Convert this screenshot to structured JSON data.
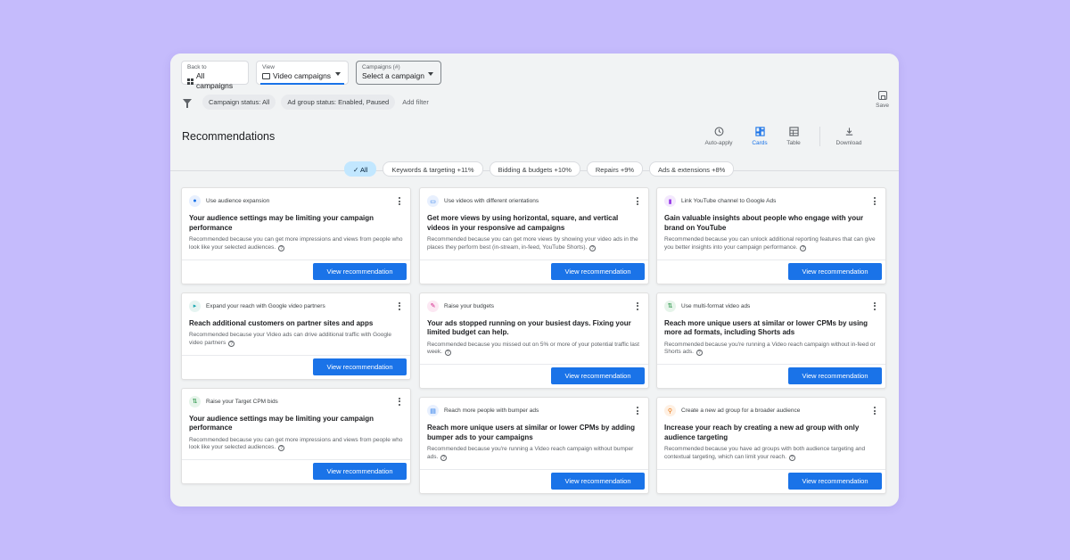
{
  "selectors": {
    "back": {
      "sub": "Back to",
      "main": "All campaigns"
    },
    "view": {
      "sub": "View",
      "main": "Video campaigns"
    },
    "campaigns": {
      "sub": "Campaigns (#)",
      "main": "Select a campaign"
    }
  },
  "filters": {
    "chips": [
      "Campaign status: All",
      "Ad group status: Enabled, Paused"
    ],
    "add_label": "Add filter"
  },
  "save_label": "Save",
  "page_title": "Recommendations",
  "view_buttons": {
    "auto_apply": "Auto-apply",
    "cards": "Cards",
    "table": "Table",
    "download": "Download"
  },
  "categories": [
    "All",
    "Keywords & targeting +11%",
    "Bidding & budgets +10%",
    "Repairs +9%",
    "Ads & extensions +8%"
  ],
  "view_recommendation_label": "View recommendation",
  "help_glyph": "?",
  "columns": [
    [
      {
        "category": "Use audience expansion",
        "icon": "person-icon",
        "headline": "Your audience settings may be limiting your campaign performance",
        "reason": "Recommended because you can get more impressions and views from people who look like your selected audiences."
      },
      {
        "category": "Expand your reach with Google video partners",
        "icon": "expand-icon",
        "headline": "Reach additional customers on partner sites and apps",
        "reason": "Recommended because your Video ads can drive additional traffic with Google video partners"
      },
      {
        "category": "Raise your Target CPM bids",
        "icon": "bids-icon",
        "headline": "Your audience settings may be limiting your campaign performance",
        "reason": "Recommended because you can get more impressions and views from people who look like your selected audiences."
      }
    ],
    [
      {
        "category": "Use videos with different orientations",
        "icon": "video-orientation-icon",
        "headline": "Get more views by using horizontal, square, and vertical videos in your responsive ad campaigns",
        "reason": "Recommended because you can get more views by showing your video ads in the places they perform best (in-stream, in-feed, YouTube Shorts)."
      },
      {
        "category": "Raise your budgets",
        "icon": "wrench-icon",
        "headline": "Your ads stopped running on your busiest days. Fixing your limited budget can help.",
        "reason": "Recommended because you missed out on 5% or more of your potential traffic last week."
      },
      {
        "category": "Reach more people with bumper ads",
        "icon": "bumper-ads-icon",
        "headline": "Reach more unique users at similar or lower CPMs by adding bumper ads to your campaigns",
        "reason": "Recommended because you're running a Video reach campaign without bumper ads."
      }
    ],
    [
      {
        "category": "Link YouTube channel to Google Ads",
        "icon": "bar-chart-icon",
        "headline": "Gain valuable insights about people who engage with your brand on YouTube",
        "reason": "Recommended because you can unlock additional reporting features that can give you better insights into your campaign performance."
      },
      {
        "category": "Use multi-format video ads",
        "icon": "multi-format-icon",
        "headline": "Reach more unique users at similar or lower CPMs by using more ad formats, including Shorts ads",
        "reason": "Recommended because you're running a Video reach campaign without in-feed or Shorts ads."
      },
      {
        "category": "Create a new ad group for a broader audience",
        "icon": "search-icon",
        "headline": "Increase your reach by creating a new ad group with only audience targeting",
        "reason": "Recommended because you have ad groups with both audience targeting and contextual targeting, which can limit your reach."
      }
    ]
  ]
}
